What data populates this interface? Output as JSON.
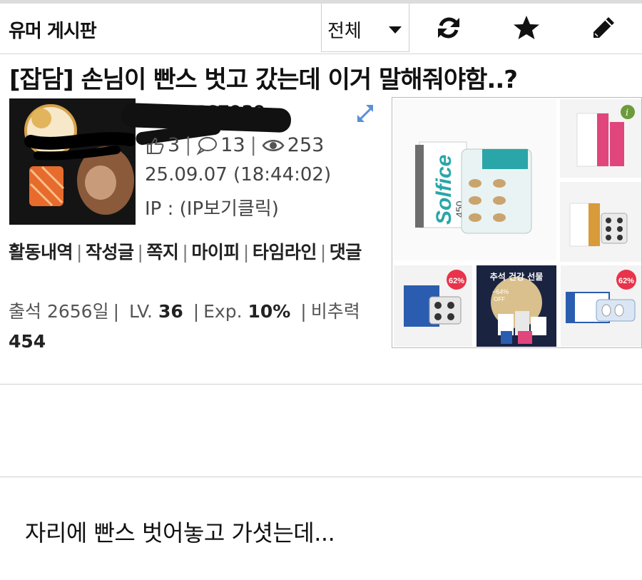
{
  "header": {
    "board_title": "유머 게시판",
    "filter_value": "전체",
    "icons": [
      "refresh-icon",
      "star-icon",
      "pencil-icon"
    ]
  },
  "post": {
    "title": "[잡담] 손님이 빤스 벗고 갔는데 이거 말해줘야함..?",
    "author_nick": "6934567939",
    "likes": "3",
    "comments": "13",
    "views": "253",
    "date": "25.09.07 (18:44:02)",
    "ip_label": "IP : ",
    "ip_link": "(IP보기클릭)",
    "user_links": [
      "활동내역",
      "작성글",
      "쪽지",
      "마이피",
      "타임라인",
      "댓글"
    ],
    "attendance_label": "출석 2656일",
    "level_label": "LV.",
    "level_value": "36",
    "exp_label": "Exp.",
    "exp_value": "10%",
    "ratio_label": "비추력",
    "ratio_value": "454",
    "body_text": "자리에 빤스 벗어놓고 가셧는데..."
  },
  "ad": {
    "brand": "Solfice",
    "product_count": "450",
    "badge_1": "62%",
    "badge_2": "62%",
    "promo_title": "추석 건강 선물",
    "promo_discount": "~64%",
    "promo_off": "OFF",
    "colors": {
      "teal": "#2aa6a8",
      "pink": "#e0457b",
      "orange": "#d99a3a",
      "blue": "#2a5db0",
      "badge": "#e8334a",
      "navy": "#1a2340"
    }
  }
}
